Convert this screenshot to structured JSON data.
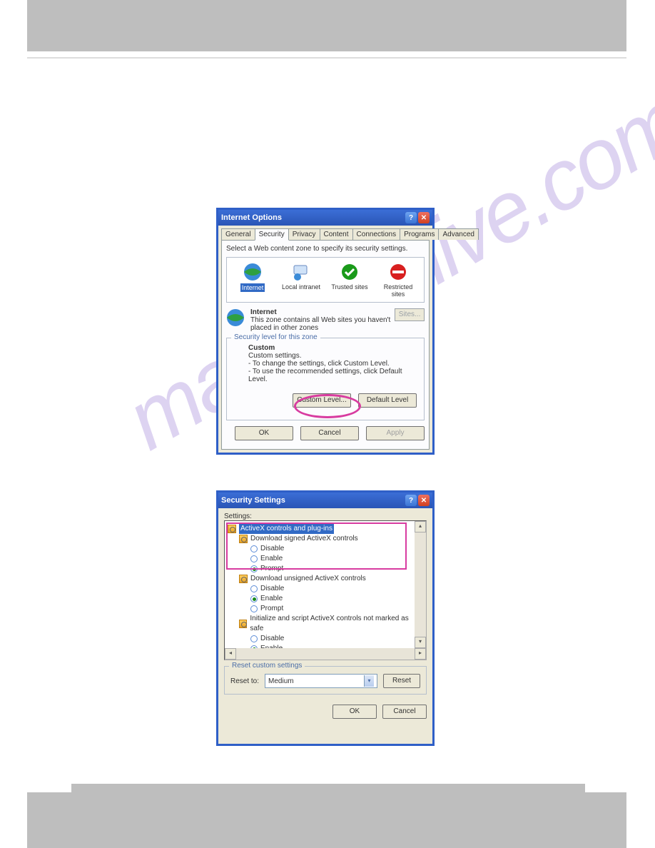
{
  "watermark": "manualshive.com",
  "io": {
    "title": "Internet Options",
    "tabs": [
      "General",
      "Security",
      "Privacy",
      "Content",
      "Connections",
      "Programs",
      "Advanced"
    ],
    "active_tab": "Security",
    "instruction": "Select a Web content zone to specify its security settings.",
    "zones": {
      "internet": "Internet",
      "local": "Local intranet",
      "trusted": "Trusted sites",
      "restricted": "Restricted sites"
    },
    "zone_desc": {
      "name": "Internet",
      "text": "This zone contains all Web sites you haven't placed in other zones"
    },
    "sites_btn": "Sites...",
    "group_title": "Security level for this zone",
    "custom": {
      "heading": "Custom",
      "l1": "Custom settings.",
      "l2": "- To change the settings, click Custom Level.",
      "l3": "- To use the recommended settings, click Default Level."
    },
    "custom_level_btn": "Custom Level...",
    "default_level_btn": "Default Level",
    "ok": "OK",
    "cancel": "Cancel",
    "apply": "Apply"
  },
  "ss": {
    "title": "Security Settings",
    "settings_label": "Settings:",
    "tree": {
      "cat1": "ActiveX controls and plug-ins",
      "sub1": "Download signed ActiveX controls",
      "sub2": "Download unsigned ActiveX controls",
      "sub3": "Initialize and script ActiveX controls not marked as safe",
      "opts": {
        "disable": "Disable",
        "enable": "Enable",
        "prompt": "Prompt"
      }
    },
    "reset_title": "Reset custom settings",
    "reset_to_label": "Reset to:",
    "reset_value": "Medium",
    "reset_btn": "Reset",
    "ok": "OK",
    "cancel": "Cancel"
  }
}
